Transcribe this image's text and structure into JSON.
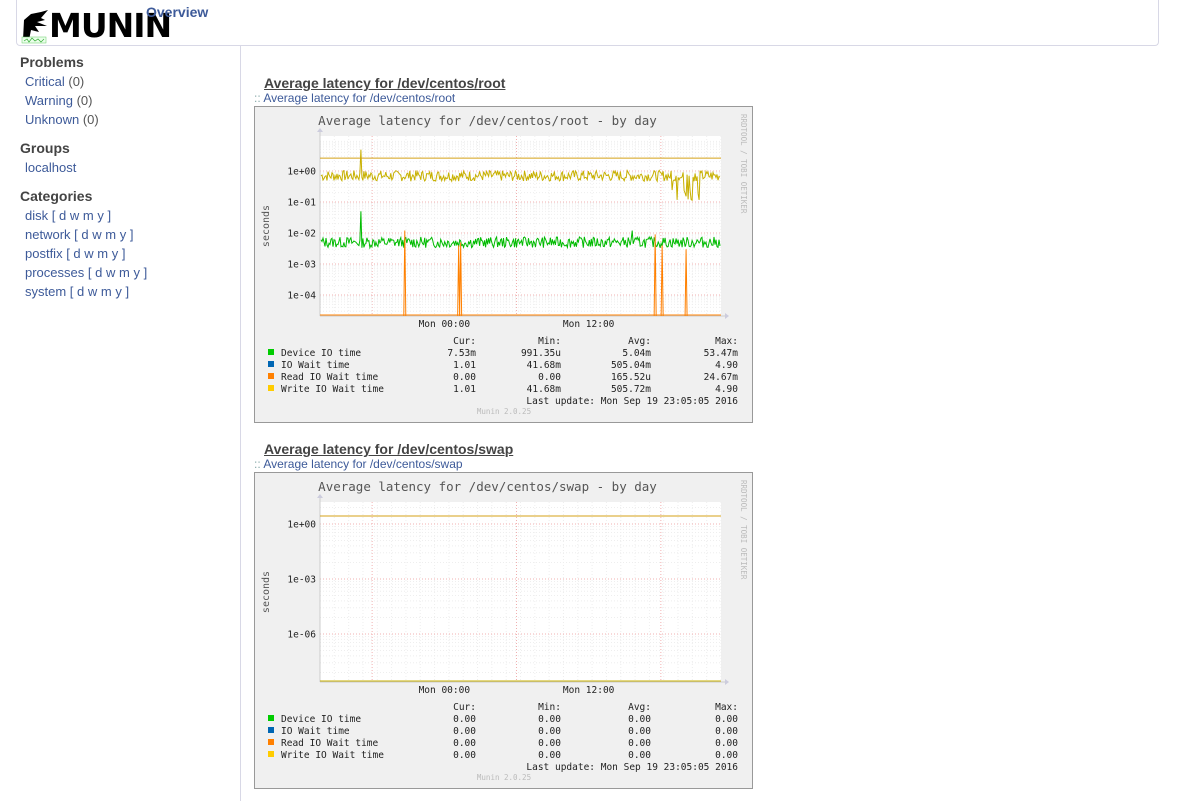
{
  "header": {
    "logo_text": "MUNIN",
    "overview_label": "Overview"
  },
  "sidebar": {
    "problems_heading": "Problems",
    "problems": [
      {
        "label": "Critical",
        "count": "(0)"
      },
      {
        "label": "Warning",
        "count": "(0)"
      },
      {
        "label": "Unknown",
        "count": "(0)"
      }
    ],
    "groups_heading": "Groups",
    "groups": [
      {
        "label": "localhost"
      }
    ],
    "categories_heading": "Categories",
    "categories": [
      {
        "label": "disk",
        "links": [
          "d",
          "w",
          "m",
          "y"
        ]
      },
      {
        "label": "network",
        "links": [
          "d",
          "w",
          "m",
          "y"
        ]
      },
      {
        "label": "postfix",
        "links": [
          "d",
          "w",
          "m",
          "y"
        ]
      },
      {
        "label": "processes",
        "links": [
          "d",
          "w",
          "m",
          "y"
        ]
      },
      {
        "label": "system",
        "links": [
          "d",
          "w",
          "m",
          "y"
        ]
      }
    ]
  },
  "graphs": [
    {
      "heading": "Average latency for /dev/centos/root",
      "sublink": "Average latency for /dev/centos/root",
      "chart_title": "Average latency for /dev/centos/root - by day",
      "ylabel": "seconds",
      "side_text": "RRDTOOL / TOBI OETIKER",
      "y_ticks": [
        "1e+00",
        "1e-01",
        "1e-02",
        "1e-03",
        "1e-04"
      ],
      "x_ticks": [
        "Mon 00:00",
        "Mon 12:00"
      ],
      "columns": [
        "Cur:",
        "Min:",
        "Avg:",
        "Max:"
      ],
      "legend": [
        {
          "name": "Device IO time",
          "color": "#00cc00",
          "values": [
            "7.53m",
            "991.35u",
            "5.04m",
            "53.47m"
          ]
        },
        {
          "name": "IO Wait time",
          "color": "#0066b3",
          "values": [
            "1.01",
            "41.68m",
            "505.04m",
            "4.90"
          ]
        },
        {
          "name": "Read IO Wait time",
          "color": "#ff8000",
          "values": [
            "0.00",
            "0.00",
            "165.52u",
            "24.67m"
          ]
        },
        {
          "name": "Write IO Wait time",
          "color": "#ffcc00",
          "values": [
            "1.01",
            "41.68m",
            "505.72m",
            "4.90"
          ]
        }
      ],
      "last_update": "Last update:  Mon Sep 19 23:05:05 2016",
      "version": "Munin 2.0.25"
    },
    {
      "heading": "Average latency for /dev/centos/swap",
      "sublink": "Average latency for /dev/centos/swap",
      "chart_title": "Average latency for /dev/centos/swap - by day",
      "ylabel": "seconds",
      "side_text": "RRDTOOL / TOBI OETIKER",
      "y_ticks": [
        "1e+00",
        "1e-03",
        "1e-06"
      ],
      "x_ticks": [
        "Mon 00:00",
        "Mon 12:00"
      ],
      "columns": [
        "Cur:",
        "Min:",
        "Avg:",
        "Max:"
      ],
      "legend": [
        {
          "name": "Device IO time",
          "color": "#00cc00",
          "values": [
            "0.00",
            "0.00",
            "0.00",
            "0.00"
          ]
        },
        {
          "name": "IO Wait time",
          "color": "#0066b3",
          "values": [
            "0.00",
            "0.00",
            "0.00",
            "0.00"
          ]
        },
        {
          "name": "Read IO Wait time",
          "color": "#ff8000",
          "values": [
            "0.00",
            "0.00",
            "0.00",
            "0.00"
          ]
        },
        {
          "name": "Write IO Wait time",
          "color": "#ffcc00",
          "values": [
            "0.00",
            "0.00",
            "0.00",
            "0.00"
          ]
        }
      ],
      "last_update": "Last update:  Mon Sep 19 23:05:05 2016",
      "version": "Munin 2.0.25"
    }
  ],
  "chart_data": [
    {
      "type": "line",
      "title": "Average latency for /dev/centos/root - by day",
      "ylabel": "seconds",
      "y_scale": "log",
      "ylim": [
        1e-05,
        3
      ],
      "x_ticks": [
        "Mon 00:00",
        "Mon 12:00"
      ],
      "series": [
        {
          "name": "Device IO time",
          "color": "#00cc00",
          "typical": 0.005,
          "spikes": [
            0.05,
            0.015,
            0.012
          ]
        },
        {
          "name": "IO Wait time",
          "color": "#0066b3",
          "typical": 0.7
        },
        {
          "name": "Read IO Wait time",
          "color": "#ff8000",
          "typical": 1e-05,
          "spikes": [
            0.012,
            0.005,
            0.003,
            0.007
          ]
        },
        {
          "name": "Write IO Wait time",
          "color": "#ffcc00",
          "typical": 0.7,
          "max": 4.9
        }
      ]
    },
    {
      "type": "line",
      "title": "Average latency for /dev/centos/swap - by day",
      "ylabel": "seconds",
      "y_scale": "log",
      "x_ticks": [
        "Mon 00:00",
        "Mon 12:00"
      ],
      "series": [
        {
          "name": "Device IO time",
          "color": "#00cc00",
          "values": [
            0
          ]
        },
        {
          "name": "IO Wait time",
          "color": "#0066b3",
          "values": [
            0
          ]
        },
        {
          "name": "Read IO Wait time",
          "color": "#ff8000",
          "values": [
            0
          ]
        },
        {
          "name": "Write IO Wait time",
          "color": "#ffcc00",
          "values": [
            0
          ]
        }
      ]
    }
  ]
}
